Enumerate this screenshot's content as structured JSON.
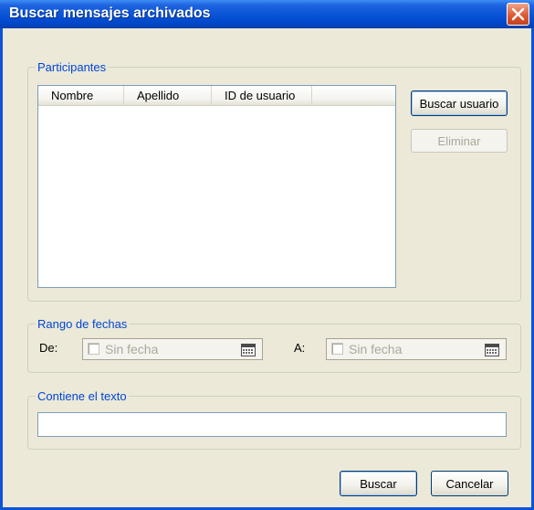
{
  "window": {
    "title": "Buscar mensajes archivados"
  },
  "participants": {
    "legend": "Participantes",
    "columns": [
      "Nombre",
      "Apellido",
      "ID de usuario"
    ],
    "rows": [],
    "search_user_label": "Buscar usuario",
    "remove_label": "Eliminar"
  },
  "date_range": {
    "legend": "Rango de fechas",
    "from_label": "De:",
    "to_label": "A:",
    "from": {
      "checked": false,
      "value": "Sin fecha"
    },
    "to": {
      "checked": false,
      "value": "Sin fecha"
    }
  },
  "contains_text": {
    "legend": "Contiene el texto",
    "value": ""
  },
  "actions": {
    "search_label": "Buscar",
    "cancel_label": "Cancelar"
  },
  "colors": {
    "titlebar": "#0a55d8",
    "legend_text": "#0046d5",
    "dialog_bg": "#ece9d8",
    "close_button": "#dc5a34"
  }
}
